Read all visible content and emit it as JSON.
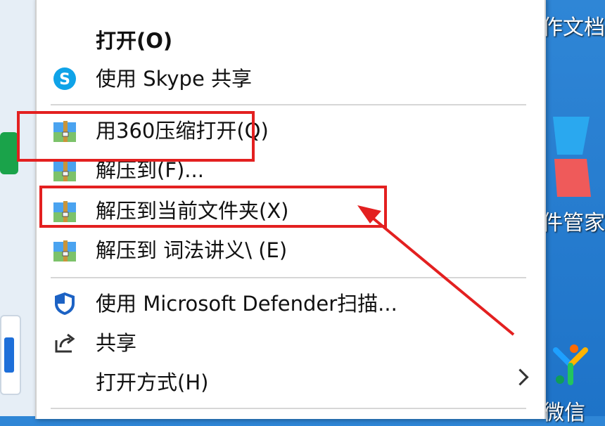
{
  "desktop": {
    "labels": [
      "作文档",
      "件管家",
      "微信"
    ]
  },
  "menu": {
    "items": [
      {
        "label": "打开(O)",
        "icon": "none",
        "bold": true
      },
      {
        "label": "使用 Skype 共享",
        "icon": "skype-icon"
      },
      {
        "label": "用360压缩打开(Q)",
        "icon": "zip-folder-icon"
      },
      {
        "label": "解压到(F)...",
        "icon": "zip-folder-icon"
      },
      {
        "label": "解压到当前文件夹(X)",
        "icon": "zip-folder-icon"
      },
      {
        "label": "解压到 词法讲义\\ (E)",
        "icon": "zip-folder-icon"
      },
      {
        "label": "使用 Microsoft Defender扫描...",
        "icon": "defender-shield-icon"
      },
      {
        "label": "共享",
        "icon": "share-icon"
      },
      {
        "label": "打开方式(H)",
        "icon": "none",
        "submenu": true
      }
    ]
  },
  "colors": {
    "highlight": "#e32020",
    "desktop_bg": "#1e73c8",
    "menu_bg": "#ffffff"
  }
}
